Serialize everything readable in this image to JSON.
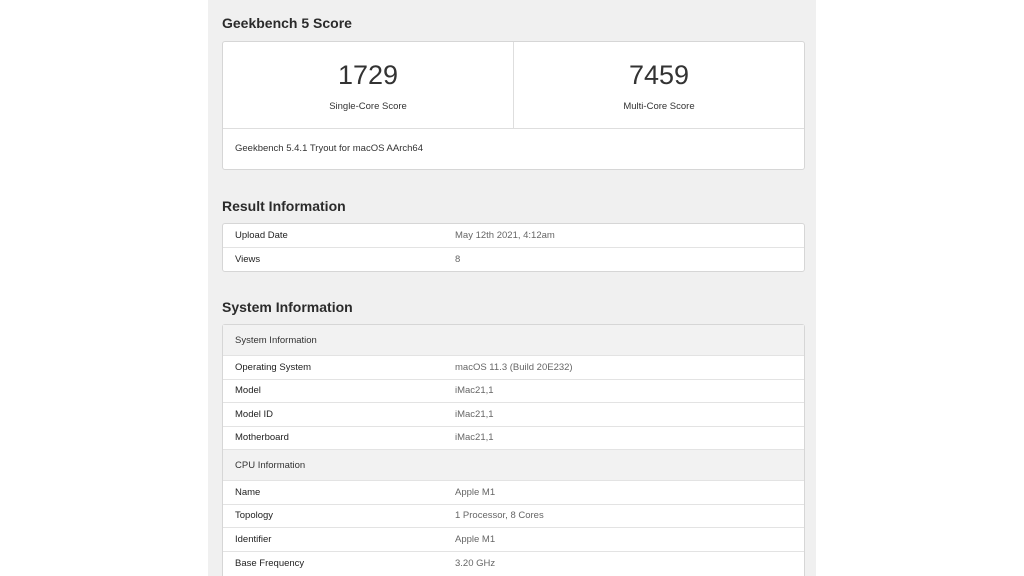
{
  "score_section": {
    "title": "Geekbench 5 Score",
    "single_core": {
      "value": "1729",
      "label": "Single-Core Score"
    },
    "multi_core": {
      "value": "7459",
      "label": "Multi-Core Score"
    },
    "version": "Geekbench 5.4.1 Tryout for macOS AArch64"
  },
  "result_section": {
    "title": "Result Information",
    "rows": [
      {
        "key": "Upload Date",
        "value": "May 12th 2021, 4:12am"
      },
      {
        "key": "Views",
        "value": "8"
      }
    ]
  },
  "system_section": {
    "title": "System Information",
    "groups": [
      {
        "heading": "System Information",
        "rows": [
          {
            "key": "Operating System",
            "value": "macOS 11.3 (Build 20E232)"
          },
          {
            "key": "Model",
            "value": "iMac21,1"
          },
          {
            "key": "Model ID",
            "value": "iMac21,1"
          },
          {
            "key": "Motherboard",
            "value": "iMac21,1"
          }
        ]
      },
      {
        "heading": "CPU Information",
        "rows": [
          {
            "key": "Name",
            "value": "Apple M1"
          },
          {
            "key": "Topology",
            "value": "1 Processor, 8 Cores"
          },
          {
            "key": "Identifier",
            "value": "Apple M1"
          },
          {
            "key": "Base Frequency",
            "value": "3.20 GHz"
          }
        ]
      }
    ]
  }
}
